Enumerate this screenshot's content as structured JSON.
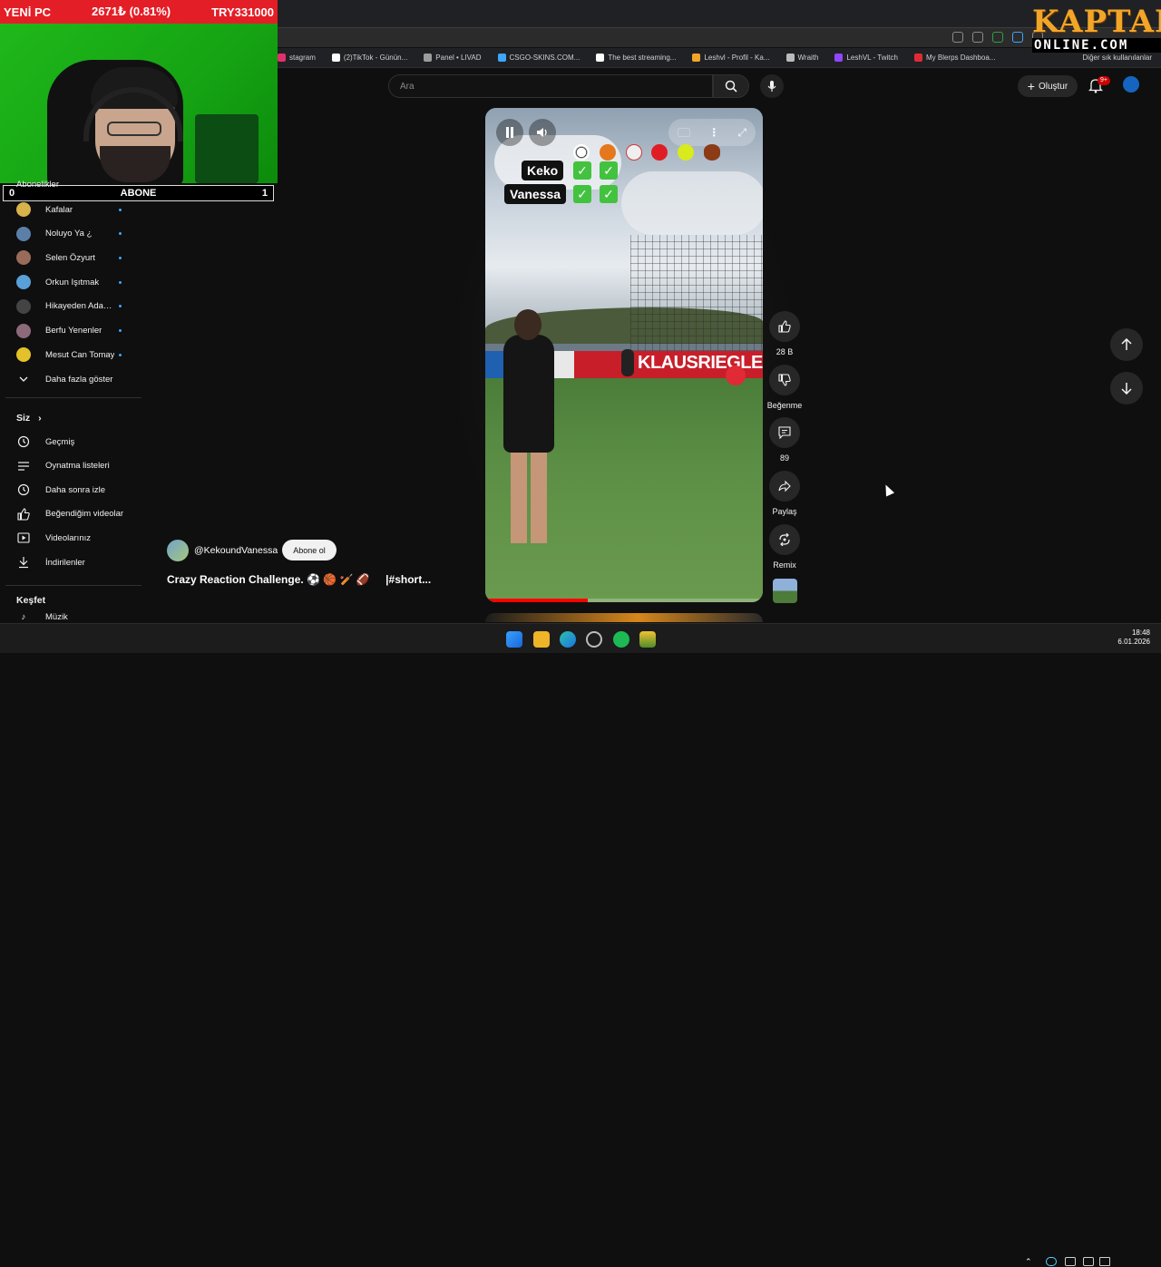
{
  "overlay": {
    "ticker_left": "YENİ PC",
    "ticker_mid": "2671₺ (0.81%)",
    "ticker_right": "TRY331000",
    "score_left": "0",
    "score_mid": "ABONE",
    "score_right": "1",
    "logo_top": "KAPTAN",
    "logo_bottom": "ONLINE.COM"
  },
  "bookmarks": [
    {
      "label": "stagram",
      "color": "#e1306c"
    },
    {
      "label": "(2)TikTok - Günün...",
      "color": "#ffffff"
    },
    {
      "label": "Panel • LIVAD",
      "color": "#9c9c9c"
    },
    {
      "label": "CSGO-SKINS.COM...",
      "color": "#3ea6ff"
    },
    {
      "label": "The best streaming...",
      "color": "#ffffff"
    },
    {
      "label": "Leshvl - Profil - Ka...",
      "color": "#f1a629"
    },
    {
      "label": "Wraith",
      "color": "#bbbbbb"
    },
    {
      "label": "LeshVL - Twitch",
      "color": "#9146ff"
    },
    {
      "label": "My Blerps Dashboa...",
      "color": "#e02a36"
    }
  ],
  "bookmarks_other": "Diğer sık kullanılanlar",
  "topbar": {
    "search_placeholder": "Ara",
    "create_label": "Oluştur",
    "notification_count": "9+"
  },
  "sidebar": {
    "subscriptions_title": "Abonelikler",
    "subscriptions": [
      {
        "label": "Kafalar",
        "color": "#d8b24a"
      },
      {
        "label": "Noluyo Ya ¿",
        "color": "#5c7fa8"
      },
      {
        "label": "Selen Özyurt",
        "color": "#9a6b58"
      },
      {
        "label": "Orkun Işıtmak",
        "color": "#5aa0d8"
      },
      {
        "label": "Hikayeden Adam...",
        "color": "#444444"
      },
      {
        "label": "Berfu Yenenler",
        "color": "#8c6a7a"
      },
      {
        "label": "Mesut Can Tomay",
        "color": "#e3c12a"
      }
    ],
    "show_more": "Daha fazla göster",
    "you_title": "Siz",
    "you_items": [
      {
        "label": "Geçmiş",
        "icon": "history-icon"
      },
      {
        "label": "Oynatma listeleri",
        "icon": "playlists-icon"
      },
      {
        "label": "Daha sonra izle",
        "icon": "watch-later-icon"
      },
      {
        "label": "Beğendiğim videolar",
        "icon": "liked-icon"
      },
      {
        "label": "Videolarınız",
        "icon": "your-videos-icon"
      },
      {
        "label": "İndirilenler",
        "icon": "downloads-icon"
      }
    ],
    "explore_title": "Keşfet",
    "explore_partial": "Müzik"
  },
  "short": {
    "name_1": "Keko",
    "name_2": "Vanessa",
    "check": "✓",
    "board_text": "KLAUSRIEGLER",
    "progress": 0.37,
    "channel": "@KekoundVanessa",
    "subscribe": "Abone ol",
    "title": "Crazy Reaction Challenge. ⚽ 🏀 🏏 🏈",
    "title_suffix": "|#short..."
  },
  "actions": {
    "like_count": "28 B",
    "dislike_label": "Beğenme",
    "comment_count": "89",
    "share_label": "Paylaş",
    "remix_label": "Remix"
  },
  "taskbar": {
    "time": "18:48",
    "date": "6.01.2026"
  }
}
